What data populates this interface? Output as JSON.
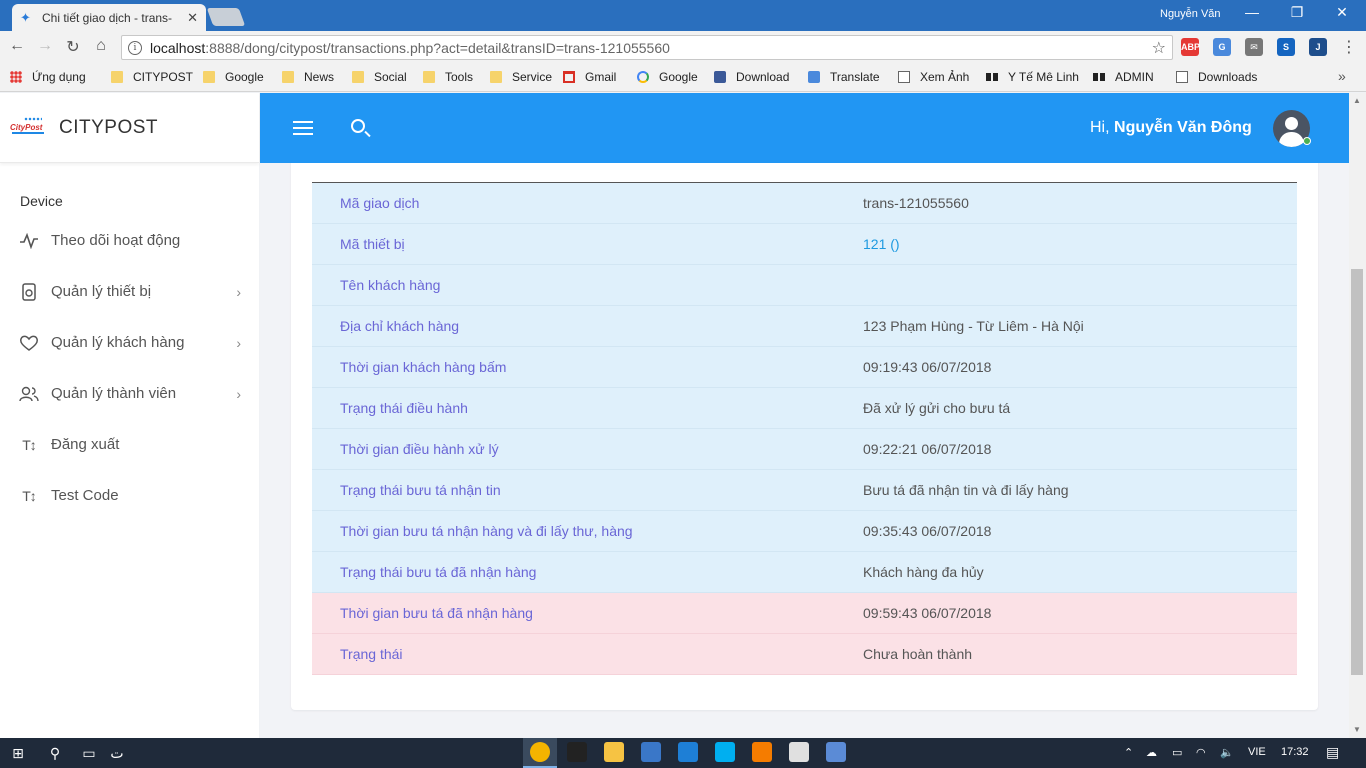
{
  "browser": {
    "tab_title": "Chi tiết giao dịch - trans-",
    "profile_name": "Nguyễn Văn",
    "url_host": "localhost",
    "url_rest": ":8888/dong/citypost/transactions.php?act=detail&transID=trans-121055560",
    "extensions": [
      {
        "name": "adblock-extension",
        "label": "ABP",
        "color": "#e53935"
      },
      {
        "name": "translate-extension",
        "label": "G",
        "color": "#4a89dc"
      },
      {
        "name": "mail-extension",
        "label": "✉",
        "color": "#777777"
      },
      {
        "name": "screen-extension",
        "label": "S",
        "color": "#1565c0"
      },
      {
        "name": "jira-extension",
        "label": "J",
        "color": "#1e4e8c"
      }
    ],
    "bookmarks": [
      {
        "label": "Ứng dụng",
        "icon": "apps"
      },
      {
        "label": "CITYPOST",
        "icon": "folder"
      },
      {
        "label": "Google",
        "icon": "folder"
      },
      {
        "label": "News",
        "icon": "folder"
      },
      {
        "label": "Social",
        "icon": "folder"
      },
      {
        "label": "Tools",
        "icon": "folder"
      },
      {
        "label": "Service",
        "icon": "folder"
      },
      {
        "label": "Gmail",
        "icon": "gmail"
      },
      {
        "label": "Google",
        "icon": "g"
      },
      {
        "label": "Download",
        "icon": "fb"
      },
      {
        "label": "Translate",
        "icon": "tr"
      },
      {
        "label": "Xem Ảnh",
        "icon": "page"
      },
      {
        "label": "Y Tế Mê Linh",
        "icon": "bow"
      },
      {
        "label": "ADMIN",
        "icon": "bow"
      },
      {
        "label": "Downloads",
        "icon": "page"
      }
    ]
  },
  "app": {
    "brand_name": "CITYPOST",
    "logo_text": "CityPost",
    "sidebar_section": "Device",
    "menu": [
      {
        "label": "Theo dõi hoạt động",
        "icon": "activity-icon",
        "has_children": false
      },
      {
        "label": "Quản lý thiết bị",
        "icon": "device-icon",
        "has_children": true
      },
      {
        "label": "Quản lý khách hàng",
        "icon": "heart-icon",
        "has_children": true
      },
      {
        "label": "Quản lý thành viên",
        "icon": "users-icon",
        "has_children": true
      },
      {
        "label": "Đăng xuất",
        "icon": "text-size-icon",
        "has_children": false
      },
      {
        "label": "Test Code",
        "icon": "text-size-icon",
        "has_children": false
      }
    ],
    "greeting": "Hi,",
    "user_name": "Nguyễn Văn Đông"
  },
  "detail": {
    "rows": [
      {
        "key": "Mã giao dịch",
        "value": "trans-121055560",
        "link": false,
        "danger": false
      },
      {
        "key": "Mã thiết bị",
        "value": "121 ()",
        "link": true,
        "danger": false
      },
      {
        "key": "Tên khách hàng",
        "value": "",
        "link": false,
        "danger": false
      },
      {
        "key": "Địa chỉ khách hàng",
        "value": "123 Phạm Hùng - Từ Liêm - Hà Nội",
        "link": false,
        "danger": false
      },
      {
        "key": "Thời gian khách hàng bấm",
        "value": "09:19:43 06/07/2018",
        "link": false,
        "danger": false
      },
      {
        "key": "Trạng thái điều hành",
        "value": "Đã xử lý gửi cho bưu tá",
        "link": false,
        "danger": false
      },
      {
        "key": "Thời gian điều hành xử lý",
        "value": "09:22:21 06/07/2018",
        "link": false,
        "danger": false
      },
      {
        "key": "Trạng thái bưu tá nhận tin",
        "value": "Bưu tá đã nhận tin và đi lấy hàng",
        "link": false,
        "danger": false
      },
      {
        "key": "Thời gian bưu tá nhận hàng và đi lấy thư, hàng",
        "value": "09:35:43 06/07/2018",
        "link": false,
        "danger": false
      },
      {
        "key": "Trạng thái bưu tá đã nhận hàng",
        "value": "Khách hàng đa hủy",
        "link": false,
        "danger": false
      },
      {
        "key": "Thời gian bưu tá đã nhận hàng",
        "value": "09:59:43 06/07/2018",
        "link": false,
        "danger": true
      },
      {
        "key": "Trạng thái",
        "value": "Chưa hoàn thành",
        "link": false,
        "danger": true
      }
    ]
  },
  "taskbar": {
    "language": "VIE",
    "clock": "17:32",
    "apps": [
      {
        "name": "chrome-app",
        "color": "#f4b400",
        "active": true
      },
      {
        "name": "phpstorm-app",
        "color": "#222222",
        "active": false
      },
      {
        "name": "file-explorer-app",
        "color": "#f6c343",
        "active": false
      },
      {
        "name": "store-app",
        "color": "#3a77c8",
        "active": false
      },
      {
        "name": "edge-app",
        "color": "#1e7fd6",
        "active": false
      },
      {
        "name": "skype-app",
        "color": "#00aff0",
        "active": false
      },
      {
        "name": "xampp-app",
        "color": "#f57c00",
        "active": false
      },
      {
        "name": "snipping-tool-app",
        "color": "#e0e0e0",
        "active": false
      },
      {
        "name": "remote-app",
        "color": "#5b8bd6",
        "active": false
      }
    ]
  }
}
